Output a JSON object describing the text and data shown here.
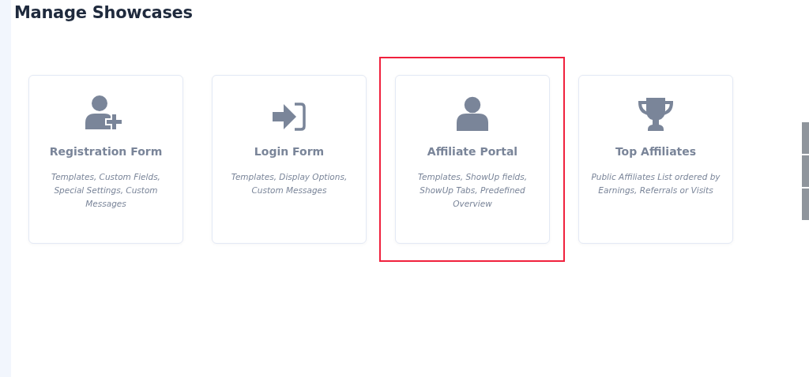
{
  "title": "Manage Showcases",
  "cards": [
    {
      "kind": "user-plus",
      "title": "Registration Form",
      "description": "Templates, Custom Fields, Special Settings, Custom Messages",
      "highlighted": false
    },
    {
      "kind": "sign-in",
      "title": "Login Form",
      "description": "Templates, Display Options, Custom Messages",
      "highlighted": false
    },
    {
      "kind": "user",
      "title": "Affiliate Portal",
      "description": "Templates, ShowUp fields, ShowUp Tabs, Predefined Overview",
      "highlighted": true
    },
    {
      "kind": "trophy",
      "title": "Top Affiliates",
      "description": "Public Affiliates List ordered by Earnings, Referrals or Visits",
      "highlighted": false
    }
  ]
}
